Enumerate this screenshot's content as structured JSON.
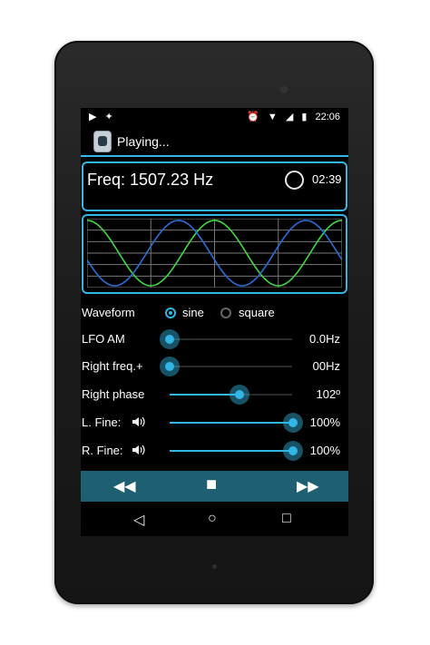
{
  "status_bar": {
    "play_icon": "play-icon",
    "android_icon": "android-icon",
    "time": "22:06"
  },
  "action_bar": {
    "title": "Playing..."
  },
  "freq_panel": {
    "frequency": "Freq: 1507.23 Hz",
    "time": "02:39"
  },
  "waveform": {
    "label": "Waveform",
    "options": [
      "sine",
      "square"
    ],
    "selected": "sine"
  },
  "sliders": [
    {
      "label": "LFO AM",
      "value": "0.0Hz",
      "level": 0.0
    },
    {
      "label": "Right freq.+",
      "value": "00Hz",
      "level": 0.0
    },
    {
      "label": "Right phase",
      "value": "102º",
      "level": 0.57
    },
    {
      "label": "L. Fine:",
      "value": "100%",
      "level": 1.0,
      "icon": "speaker-icon"
    },
    {
      "label": "R. Fine:",
      "value": "100%",
      "level": 1.0,
      "icon": "speaker-icon"
    }
  ],
  "transport": {
    "rewind": "◀◀",
    "stop": "■",
    "forward": "▶▶"
  },
  "nav": {
    "back": "◁",
    "home": "○",
    "recents": "□"
  },
  "colors": {
    "accent": "#33b5e5",
    "sine_left": "#3fd93f",
    "sine_right": "#2a6fd6",
    "transport_bg": "#1f5f72"
  }
}
